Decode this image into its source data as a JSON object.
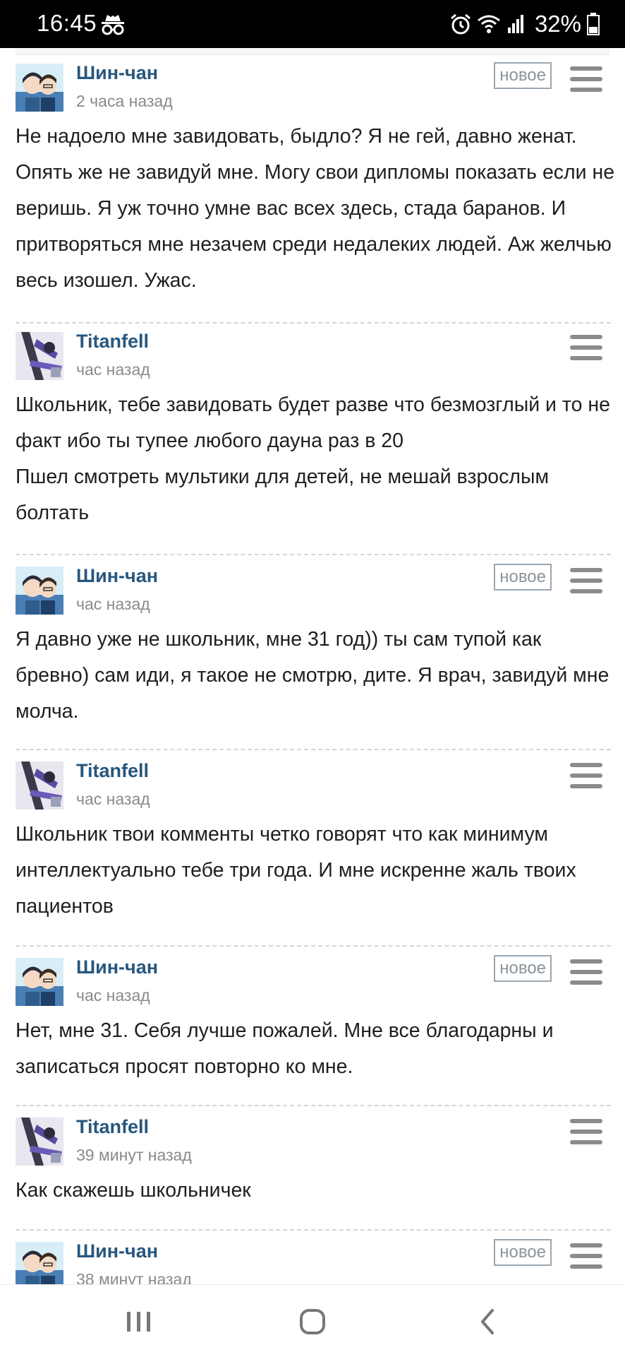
{
  "status_bar": {
    "time": "16:45",
    "battery": "32%",
    "icons": [
      "incognito-icon",
      "alarm-icon",
      "wifi-icon",
      "signal-icon",
      "battery-icon"
    ]
  },
  "comments": [
    {
      "author": "Шин-чан",
      "time": "2 часа назад",
      "badge": "новое",
      "avatar": "conan-avatar",
      "text": "Не надоело мне завидовать, быдло? Я не гей, давно женат. Опять же не завидуй мне. Могу свои дипломы показать если не веришь. Я уж точно умне вас всех здесь, стада баранов. И притворяться мне незачем среди недалеких людей. Аж желчью весь изошел. Ужас."
    },
    {
      "author": "Titanfell",
      "time": "час назад",
      "badge": "",
      "avatar": "titanfell-avatar",
      "text": "Школьник, тебе завидовать будет разве что безмозглый и то не факт ибо ты тупее любого дауна раз в 20\nПшел смотреть мультики для детей, не мешай взрослым болтать"
    },
    {
      "author": "Шин-чан",
      "time": "час назад",
      "badge": "новое",
      "avatar": "conan-avatar",
      "text": "Я давно уже не школьник, мне 31 год)) ты сам тупой как бревно) сам иди, я такое не смотрю, дите. Я врач, завидуй мне молча."
    },
    {
      "author": "Titanfell",
      "time": "час назад",
      "badge": "",
      "avatar": "titanfell-avatar",
      "text": "Школьник твои комменты четко говорят что как минимум интеллектуально тебе три года. И мне искренне жаль твоих пациентов"
    },
    {
      "author": "Шин-чан",
      "time": "час назад",
      "badge": "новое",
      "avatar": "conan-avatar",
      "text": "Нет, мне 31. Себя лучше пожалей. Мне все благодарны и записаться просят повторно ко мне."
    },
    {
      "author": "Titanfell",
      "time": "39 минут назад",
      "badge": "",
      "avatar": "titanfell-avatar",
      "text": "Как скажешь школьничек"
    },
    {
      "author": "Шин-чан",
      "time": "38 минут назад",
      "badge": "новое",
      "avatar": "conan-avatar",
      "text": ""
    }
  ],
  "nav_bar": {
    "buttons": [
      "recent-apps-icon",
      "home-icon",
      "back-icon"
    ]
  },
  "colors": {
    "author": "#27577e",
    "timestamp": "#8a8a8a",
    "badge_border": "#9aa7b2",
    "menu": "#8b8b8b",
    "status_bar_bg": "#000000"
  }
}
